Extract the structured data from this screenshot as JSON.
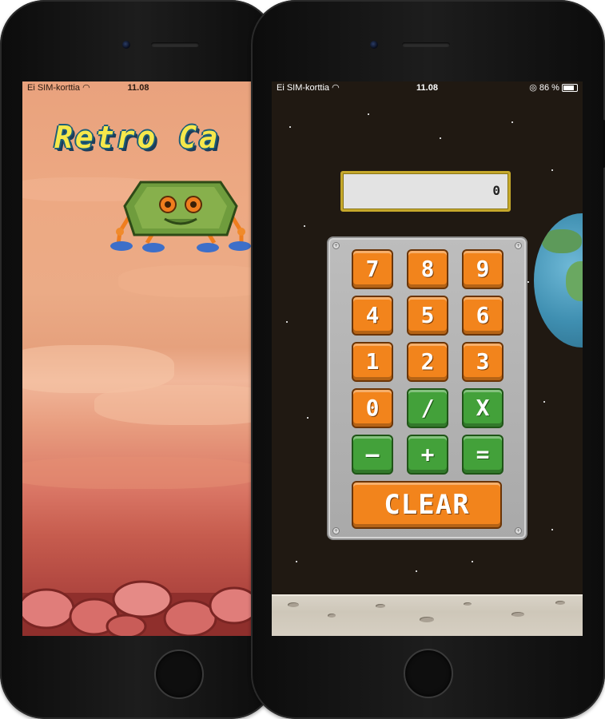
{
  "left_phone": {
    "status": {
      "carrier": "Ei SIM-korttia",
      "time": "11.08"
    },
    "splash_title": "Retro Ca"
  },
  "right_phone": {
    "status": {
      "carrier": "Ei SIM-korttia",
      "time": "11.08",
      "battery": "86 %"
    },
    "display_value": "0",
    "keys": {
      "k7": "7",
      "k8": "8",
      "k9": "9",
      "k4": "4",
      "k5": "5",
      "k6": "6",
      "k1": "1",
      "k2": "2",
      "k3": "3",
      "k0": "0",
      "divide": "/",
      "multiply": "X",
      "minus": "—",
      "plus": "+",
      "equals": "=",
      "clear": "CLEAR"
    }
  },
  "colors": {
    "key_orange": "#f2841c",
    "key_green": "#43a13a",
    "display_border": "#c5a82b",
    "title_yellow": "#f6e84b"
  }
}
